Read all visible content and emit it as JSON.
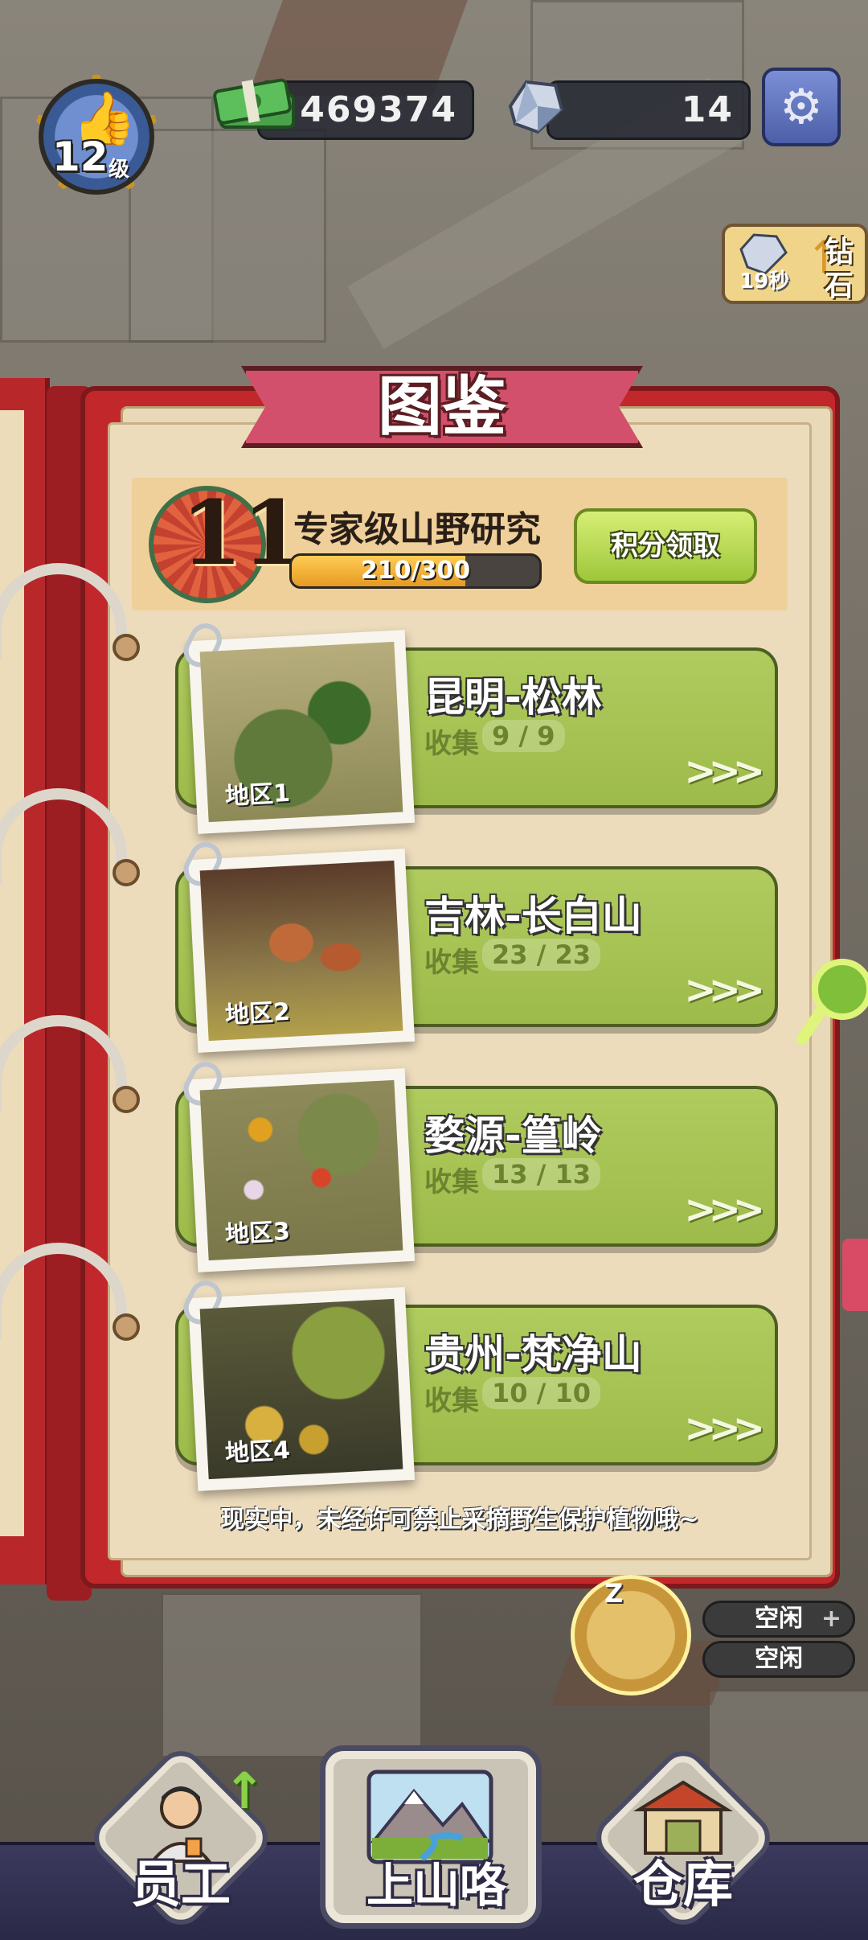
{
  "hud": {
    "level": "12",
    "level_unit": "级",
    "cash": "469374",
    "gems": "14"
  },
  "diamond_offer": {
    "timer": "19秒",
    "label_line1": "钻",
    "label_line2": "石"
  },
  "codex": {
    "title": "图鉴",
    "rank_number": "11",
    "rank_title": "专家级山野研究",
    "progress_text": "210/300",
    "progress_fraction": 0.7,
    "claim_button": "积分领取",
    "regions": [
      {
        "name": "昆明-松林",
        "collect_label": "收集",
        "collect_value": "9 / 9",
        "region_label": "地区1"
      },
      {
        "name": "吉林-长白山",
        "collect_label": "收集",
        "collect_value": "23 / 23",
        "region_label": "地区2"
      },
      {
        "name": "婺源-篁岭",
        "collect_label": "收集",
        "collect_value": "13 / 13",
        "region_label": "地区3"
      },
      {
        "name": "贵州-梵净山",
        "collect_label": "收集",
        "collect_value": "10 / 10",
        "region_label": "地区4"
      }
    ],
    "footer_note": "现实中，未经许可禁止采摘野生保护植物哦~"
  },
  "status": {
    "sleep_marker": "Z",
    "slots": [
      "空闲",
      "空闲"
    ],
    "plus": "+"
  },
  "nav": {
    "staff": "员工",
    "mountain": "上山咯",
    "warehouse": "仓库"
  },
  "colors": {
    "card_green": "#a7c454",
    "cover_red": "#c2272c",
    "ribbon_pink": "#d2506b",
    "page_cream": "#ecdcbc"
  }
}
